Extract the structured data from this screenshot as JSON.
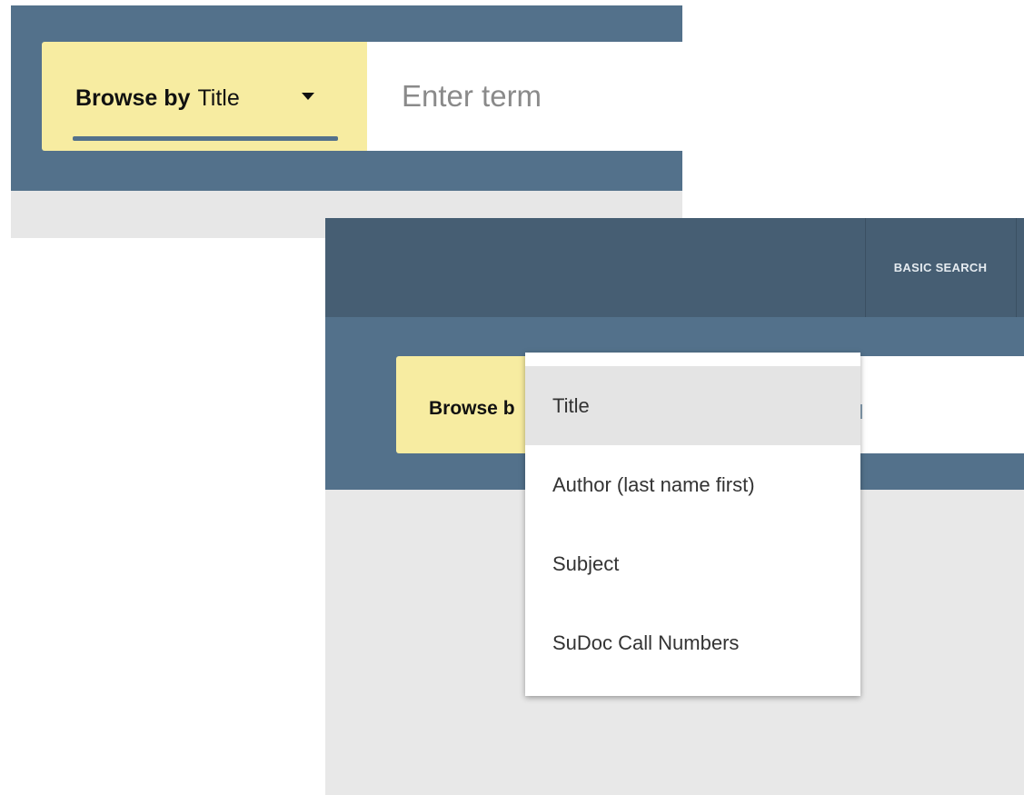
{
  "top_view": {
    "browse_label": "Browse by",
    "browse_value": "Title",
    "search_placeholder": "Enter term"
  },
  "bottom_view": {
    "nav": {
      "basic_search_label": "BASIC SEARCH"
    },
    "browse_label": "Browse b",
    "dropdown": {
      "selected": "Title",
      "options": [
        {
          "label": "Title"
        },
        {
          "label": "Author (last name first)"
        },
        {
          "label": "Subject"
        },
        {
          "label": "SuDoc Call Numbers"
        }
      ]
    }
  },
  "colors": {
    "header_bar": "#53718b",
    "nav_bar": "#465e73",
    "browse_box": "#f7eca1",
    "page_background": "#e8e8e8",
    "selected_option": "#e4e4e4"
  },
  "icons": {
    "dropdown_caret": "caret-down-icon"
  }
}
